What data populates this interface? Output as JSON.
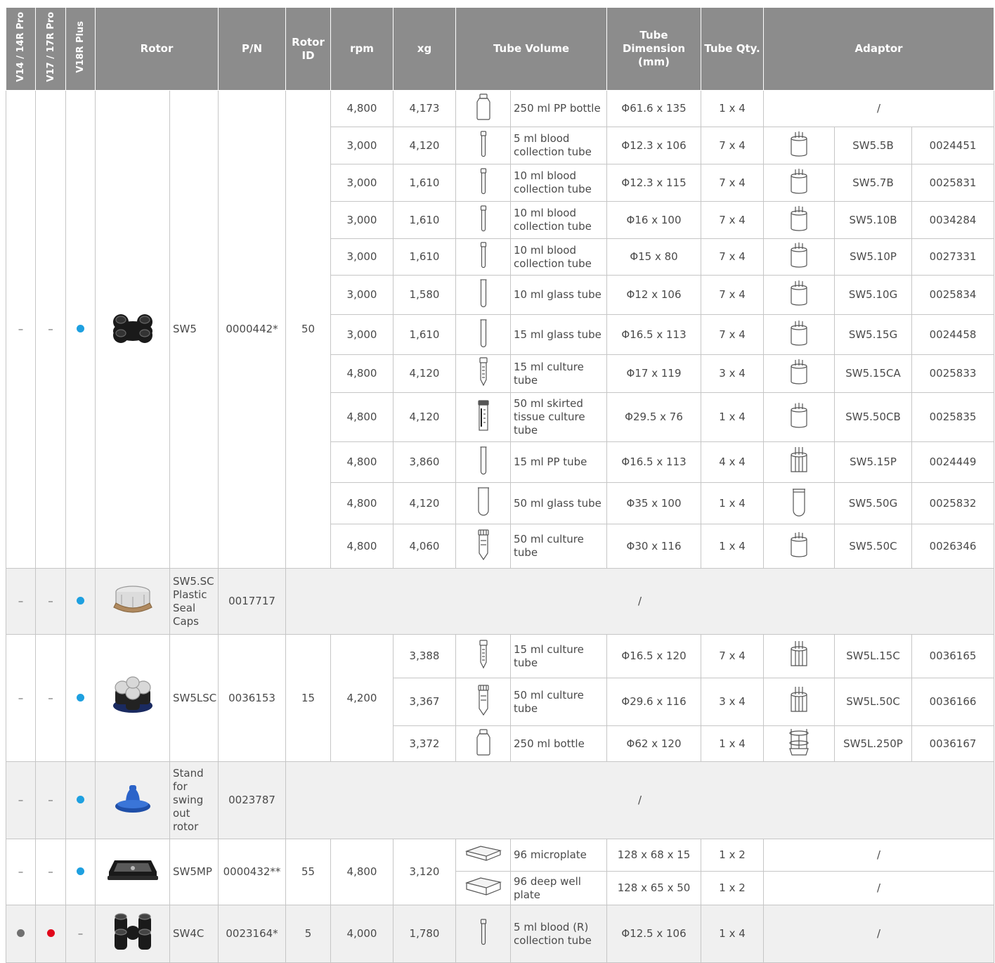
{
  "headers": {
    "v14": "V14 / 14R Pro",
    "v17": "V17 / 17R Pro",
    "v18": "V18R Plus",
    "rotor": "Rotor",
    "pn": "P/N",
    "rotor_id": "Rotor ID",
    "rpm": "rpm",
    "xg": "xg",
    "tube_volume": "Tube Volume",
    "tube_dimension": "Tube Dimension (mm)",
    "tube_qty": "Tube Qty.",
    "adaptor": "Adaptor"
  },
  "colors": {
    "blue_dot": "#1ea0e0",
    "red_dot": "#e1061a",
    "grey_dot": "#707070",
    "header_bg": "#8c8c8c"
  },
  "sw5": {
    "v14": "–",
    "v17": "–",
    "rotor": "SW5",
    "pn": "0000442*",
    "rotor_id": "50",
    "rows": [
      {
        "rpm": "4,800",
        "xg": "4,173",
        "tube": "250 ml PP bottle",
        "tube_icon": "bottle-icon",
        "dim": "Φ61.6 x 135",
        "qty": "1 x 4",
        "adaptor": "/"
      },
      {
        "rpm": "3,000",
        "xg": "4,120",
        "tube": "5 ml blood collection tube",
        "tube_icon": "blood-tube-icon",
        "dim": "Φ12.3 x 106",
        "qty": "7 x 4",
        "adp_icon": "adaptor-cup-icon",
        "adp_name": "SW5.5B",
        "adp_pn": "0024451"
      },
      {
        "rpm": "3,000",
        "xg": "1,610",
        "tube": "10 ml blood collection tube",
        "tube_icon": "blood-tube-icon",
        "dim": "Φ12.3 x 115",
        "qty": "7 x 4",
        "adp_icon": "adaptor-cup-icon",
        "adp_name": "SW5.7B",
        "adp_pn": "0025831"
      },
      {
        "rpm": "3,000",
        "xg": "1,610",
        "tube": "10 ml blood collection tube",
        "tube_icon": "blood-tube-icon",
        "dim": "Φ16 x 100",
        "qty": "7 x 4",
        "adp_icon": "adaptor-cup-icon",
        "adp_name": "SW5.10B",
        "adp_pn": "0034284"
      },
      {
        "rpm": "3,000",
        "xg": "1,610",
        "tube": "10 ml blood collection tube",
        "tube_icon": "blood-tube-icon",
        "dim": "Φ15 x 80",
        "qty": "7 x 4",
        "adp_icon": "adaptor-cup-icon",
        "adp_name": "SW5.10P",
        "adp_pn": "0027331"
      },
      {
        "rpm": "3,000",
        "xg": "1,580",
        "tube": "10 ml glass tube",
        "tube_icon": "glass-tube-icon",
        "dim": "Φ12 x 106",
        "qty": "7 x 4",
        "adp_icon": "adaptor-cup-icon",
        "adp_name": "SW5.10G",
        "adp_pn": "0025834"
      },
      {
        "rpm": "3,000",
        "xg": "1,610",
        "tube": "15 ml glass tube",
        "tube_icon": "glass-tube-icon",
        "dim": "Φ16.5 x 113",
        "qty": "7 x 4",
        "adp_icon": "adaptor-cup-icon",
        "adp_name": "SW5.15G",
        "adp_pn": "0024458"
      },
      {
        "rpm": "4,800",
        "xg": "4,120",
        "tube": "15 ml culture tube",
        "tube_icon": "culture-tube-icon",
        "dim": "Φ17 x 119",
        "qty": "3 x 4",
        "adp_icon": "adaptor-cup-icon",
        "adp_name": "SW5.15CA",
        "adp_pn": "0025833"
      },
      {
        "rpm": "4,800",
        "xg": "4,120",
        "tube": "50 ml skirted tissue culture tube",
        "tube_icon": "skirted-tube-icon",
        "dim": "Φ29.5 x 76",
        "qty": "1 x 4",
        "adp_icon": "adaptor-cup-icon",
        "adp_name": "SW5.50CB",
        "adp_pn": "0025835"
      },
      {
        "rpm": "4,800",
        "xg": "3,860",
        "tube": "15 ml PP tube",
        "tube_icon": "glass-tube-icon",
        "dim": "Φ16.5 x 113",
        "qty": "4 x 4",
        "adp_icon": "adaptor-rack-icon",
        "adp_name": "SW5.15P",
        "adp_pn": "0024449"
      },
      {
        "rpm": "4,800",
        "xg": "4,120",
        "tube": "50 ml glass tube",
        "tube_icon": "wide-tube-icon",
        "dim": "Φ35 x 100",
        "qty": "1 x 4",
        "adp_icon": "adaptor-tube-icon",
        "adp_name": "SW5.50G",
        "adp_pn": "0025832"
      },
      {
        "rpm": "4,800",
        "xg": "4,060",
        "tube": "50 ml culture tube",
        "tube_icon": "conical-tube-icon",
        "dim": "Φ30 x 116",
        "qty": "1 x 4",
        "adp_icon": "adaptor-cup-icon",
        "adp_name": "SW5.50C",
        "adp_pn": "0026346"
      }
    ]
  },
  "sw5sc": {
    "v14": "–",
    "v17": "–",
    "rotor": "SW5.SC Plastic Seal Caps",
    "pn": "0017717",
    "span": "/"
  },
  "sw5lsc": {
    "v14": "–",
    "v17": "–",
    "rotor": "SW5LSC",
    "pn": "0036153",
    "rotor_id": "15",
    "rpm": "4,200",
    "rows": [
      {
        "xg": "3,388",
        "tube": "15 ml culture tube",
        "tube_icon": "culture-tube-icon",
        "dim": "Φ16.5 x 120",
        "qty": "7 x 4",
        "adp_icon": "adaptor-rack-icon",
        "adp_name": "SW5L.15C",
        "adp_pn": "0036165"
      },
      {
        "xg": "3,367",
        "tube": "50 ml culture tube",
        "tube_icon": "conical-tube-icon",
        "dim": "Φ29.6 x 116",
        "qty": "3 x 4",
        "adp_icon": "adaptor-rack-icon",
        "adp_name": "SW5L.50C",
        "adp_pn": "0036166"
      },
      {
        "xg": "3,372",
        "tube": "250 ml bottle",
        "tube_icon": "bottle-icon",
        "dim": "Φ62 x 120",
        "qty": "1 x 4",
        "adp_icon": "adaptor-holder-icon",
        "adp_name": "SW5L.250P",
        "adp_pn": "0036167"
      }
    ]
  },
  "stand": {
    "v14": "–",
    "v17": "–",
    "rotor": "Stand for swing out rotor",
    "pn": "0023787",
    "span": "/"
  },
  "sw5mp": {
    "v14": "–",
    "v17": "–",
    "rotor": "SW5MP",
    "pn": "0000432**",
    "rotor_id": "55",
    "rpm": "4,800",
    "xg": "3,120",
    "rows": [
      {
        "tube": "96 microplate",
        "tube_icon": "microplate-icon",
        "dim": "128 x 68 x 15",
        "qty": "1 x 2",
        "adaptor": "/"
      },
      {
        "tube": "96 deep well plate",
        "tube_icon": "deepwell-plate-icon",
        "dim": "128 x 65 x 50",
        "qty": "1 x 2",
        "adaptor": "/"
      }
    ]
  },
  "sw4c": {
    "v18": "–",
    "rotor": "SW4C",
    "pn": "0023164*",
    "rotor_id": "5",
    "rpm": "4,000",
    "xg": "1,780",
    "tube": "5 ml blood (R) collection tube",
    "tube_icon": "blood-tube-icon",
    "dim": "Φ12.5 x 106",
    "qty": "1 x 4",
    "adaptor": "/"
  }
}
